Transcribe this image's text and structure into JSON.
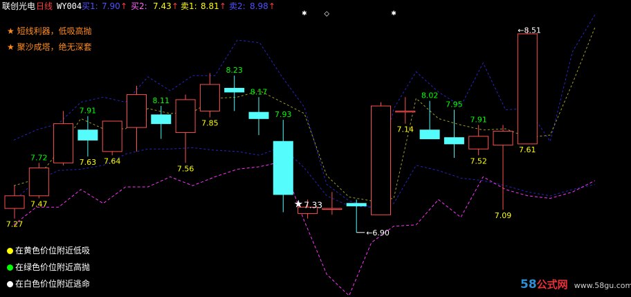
{
  "header": {
    "stock_name": "联创光电",
    "period": "日线",
    "indicator": "WY004",
    "items": [
      {
        "label": "买1:",
        "value": "7.90",
        "arrow": "↑"
      },
      {
        "label": "买2:",
        "value": "7.43",
        "arrow": "↑"
      },
      {
        "label": "卖1:",
        "value": "8.81",
        "arrow": "↑"
      },
      {
        "label": "卖2:",
        "value": "8.98",
        "arrow": "↑"
      }
    ]
  },
  "notes": [
    "短线利器，低吸高抛",
    "聚沙成塔，绝无深套"
  ],
  "legend": [
    {
      "text": "在黄色价位附近低吸",
      "color": "#ffff00"
    },
    {
      "text": "在绿色价位附近高抛",
      "color": "#00ff00"
    },
    {
      "text": "在白色价位附近逃命",
      "color": "#ffffff"
    }
  ],
  "watermark": {
    "num": "58",
    "cn": "公式网",
    "url": "www.58gu.com"
  },
  "colors": {
    "up": "#ff5050",
    "down": "#54fcfc",
    "buy_label": "#ffff00",
    "sell_label": "#00ff00",
    "line_blue": "#2626c8",
    "line_olive": "#a0a024",
    "line_magenta": "#ff33ff",
    "text_white": "#ffffff"
  },
  "chart_data": {
    "type": "candlestick",
    "ylim": [
      6.4,
      8.66
    ],
    "candles": [
      {
        "o": 7.1,
        "h": 7.28,
        "l": 7.02,
        "c": 7.2
      },
      {
        "o": 7.2,
        "h": 7.46,
        "l": 7.18,
        "c": 7.42
      },
      {
        "o": 7.46,
        "h": 7.87,
        "l": 7.44,
        "c": 7.77
      },
      {
        "o": 7.72,
        "h": 7.83,
        "l": 7.51,
        "c": 7.64
      },
      {
        "o": 7.55,
        "h": 7.78,
        "l": 7.52,
        "c": 7.79
      },
      {
        "o": 7.74,
        "h": 8.07,
        "l": 7.55,
        "c": 8.0
      },
      {
        "o": 7.84,
        "h": 7.91,
        "l": 7.65,
        "c": 7.77
      },
      {
        "o": 7.7,
        "h": 8.0,
        "l": 7.46,
        "c": 7.96
      },
      {
        "o": 7.87,
        "h": 8.17,
        "l": 7.82,
        "c": 8.08
      },
      {
        "o": 8.05,
        "h": 8.15,
        "l": 7.87,
        "c": 8.02
      },
      {
        "o": 7.86,
        "h": 7.98,
        "l": 7.68,
        "c": 7.81
      },
      {
        "o": 7.63,
        "h": 7.8,
        "l": 7.07,
        "c": 7.21
      },
      {
        "o": 7.06,
        "h": 7.17,
        "l": 7.02,
        "c": 7.11
      },
      {
        "o": 7.1,
        "h": 7.23,
        "l": 7.05,
        "c": 7.1
      },
      {
        "o": 7.14,
        "h": 7.17,
        "l": 6.91,
        "c": 7.12
      },
      {
        "o": 7.05,
        "h": 7.94,
        "l": 7.05,
        "c": 7.91
      },
      {
        "o": 7.87,
        "h": 7.98,
        "l": 7.77,
        "c": 7.87
      },
      {
        "o": 7.72,
        "h": 7.95,
        "l": 7.66,
        "c": 7.65
      },
      {
        "o": 7.66,
        "h": 7.88,
        "l": 7.5,
        "c": 7.61
      },
      {
        "o": 7.57,
        "h": 7.76,
        "l": 7.52,
        "c": 7.67
      },
      {
        "o": 7.6,
        "h": 7.76,
        "l": 7.09,
        "c": 7.71
      },
      {
        "o": 7.61,
        "h": 8.51,
        "l": 7.61,
        "c": 8.48
      }
    ],
    "buy_labels": [
      {
        "i": 0,
        "text": "7.27"
      },
      {
        "i": 1,
        "text": "7.47"
      },
      {
        "i": 3,
        "text": "7.63"
      },
      {
        "i": 4,
        "text": "7.64"
      },
      {
        "i": 7,
        "text": "7.56"
      },
      {
        "i": 8,
        "text": "7.85"
      },
      {
        "i": 16,
        "text": "7.14"
      },
      {
        "i": 19,
        "text": "7.52"
      },
      {
        "i": 20,
        "text": "7.09"
      },
      {
        "i": 21,
        "text": "7.61"
      }
    ],
    "sell_labels": [
      {
        "i": 1,
        "text": "7.72"
      },
      {
        "i": 3,
        "text": "7.91"
      },
      {
        "i": 6,
        "text": "8.11"
      },
      {
        "i": 9,
        "text": "8.23"
      },
      {
        "i": 10,
        "text": "8.17"
      },
      {
        "i": 11,
        "text": "7.93"
      },
      {
        "i": 17,
        "text": "8.02"
      },
      {
        "i": 18,
        "text": "7.95"
      },
      {
        "i": 19,
        "text": "7.91"
      }
    ],
    "annotations": [
      {
        "type": "star",
        "i": 11,
        "text": "7.33"
      },
      {
        "type": "low",
        "i": 14,
        "text": "6.90"
      },
      {
        "type": "high",
        "i": 21,
        "text": "8.51"
      }
    ],
    "lines": [
      {
        "name": "",
        "style": "blue",
        "values": [
          7.64,
          7.72,
          7.77,
          7.94,
          7.98,
          7.94,
          8.14,
          8.03,
          8.15,
          8.15,
          8.43,
          8.41,
          8.14,
          7.9,
          7.29,
          7.16,
          7.11,
          7.89,
          8.18,
          8.02,
          7.91,
          8.25,
          7.88,
          7.89,
          7.63,
          8.34,
          8.63
        ]
      },
      {
        "name": "",
        "style": "olive",
        "values": [
          7.28,
          7.33,
          7.55,
          7.81,
          7.73,
          7.73,
          7.89,
          7.85,
          7.86,
          7.97,
          7.98,
          8.03,
          7.94,
          7.85,
          7.36,
          7.19,
          7.16,
          7.18,
          7.97,
          7.81,
          7.76,
          7.72,
          7.73,
          7.66,
          7.68,
          8.09,
          8.53
        ]
      },
      {
        "name": "",
        "style": "blue",
        "values": [
          7.16,
          7.32,
          7.4,
          7.41,
          7.44,
          7.53,
          7.57,
          7.57,
          7.58,
          7.56,
          7.55,
          7.52,
          7.59,
          7.42,
          7.2,
          7.12,
          7.11,
          7.14,
          7.44,
          7.4,
          7.34,
          7.32,
          7.28,
          7.23,
          7.2,
          7.25,
          7.29
        ]
      },
      {
        "name": "",
        "style": "magenta",
        "values": [
          6.97,
          7.11,
          7.11,
          7.25,
          7.14,
          7.27,
          7.27,
          7.35,
          7.28,
          7.35,
          7.41,
          7.43,
          7.47,
          7.0,
          6.58,
          6.41,
          6.83,
          6.96,
          6.97,
          7.17,
          7.03,
          7.35,
          7.25,
          7.2,
          7.18,
          7.23,
          7.32
        ]
      }
    ],
    "markers": [
      {
        "type": "cross",
        "i": 8
      },
      {
        "type": "diamond",
        "i": 9
      },
      {
        "type": "cross",
        "i": 12
      }
    ]
  }
}
